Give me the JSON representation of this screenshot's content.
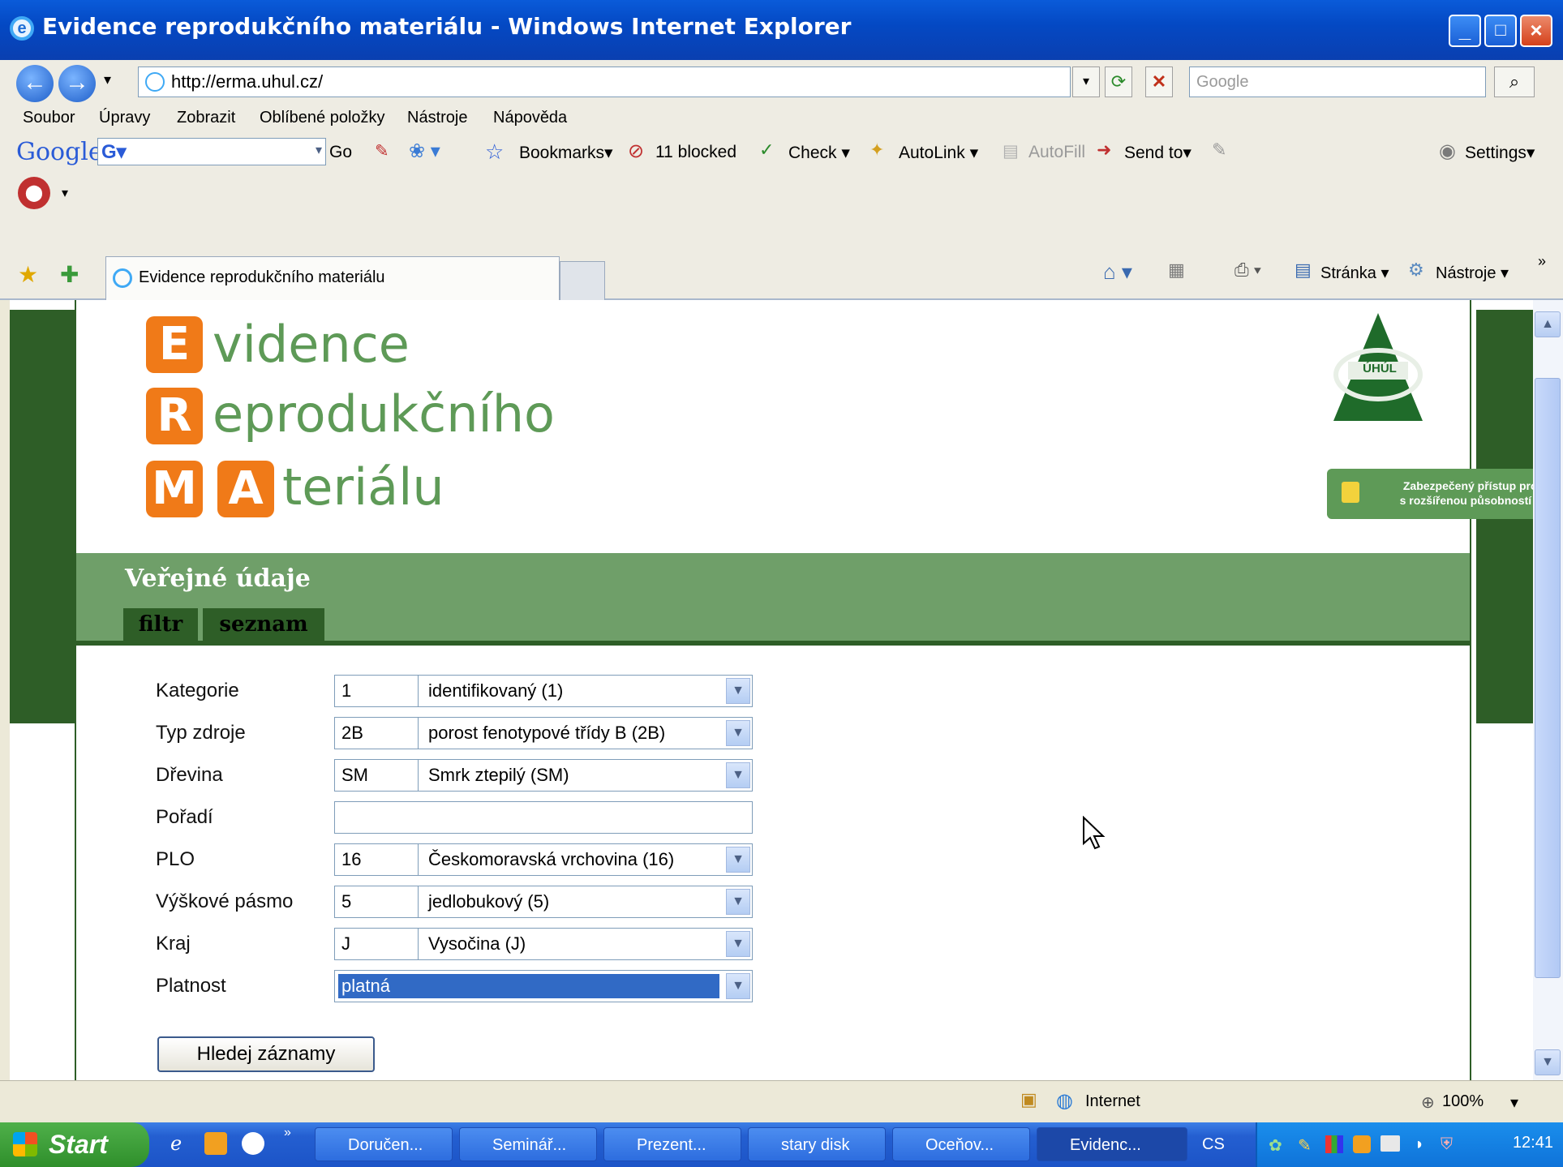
{
  "window": {
    "title": "Evidence reprodukčního materiálu - Windows Internet Explorer"
  },
  "address": {
    "url": "http://erma.uhul.cz/",
    "search_placeholder": "Google"
  },
  "menu": [
    "Soubor",
    "Úpravy",
    "Zobrazit",
    "Oblíbené položky",
    "Nástroje",
    "Nápověda"
  ],
  "google_toolbar": {
    "brand": "Google",
    "go": "Go",
    "bookmarks": "Bookmarks",
    "blocked": "11 blocked",
    "check": "Check",
    "autolink": "AutoLink",
    "autofill": "AutoFill",
    "send_to": "Send to",
    "settings": "Settings"
  },
  "tabs": {
    "active_tab": "Evidence reprodukčního materiálu",
    "page": "Stránka",
    "tools": "Nástroje"
  },
  "logo": {
    "l1_letter": "E",
    "l1_word": "vidence",
    "l2_letter": "R",
    "l2_word": "eprodukčního",
    "l3_letter1": "M",
    "l3_letter2": "A",
    "l3_word": "teriálu"
  },
  "emblem_text": "ÚHÚL",
  "secure_link": {
    "line1": "Zabezpečený přístup pro obce",
    "line2": "s rozšířenou působností a kraje",
    "arrow": ">"
  },
  "section": {
    "title": "Veřejné údaje",
    "tab_filtr": "filtr",
    "tab_seznam": "seznam"
  },
  "form": {
    "rows": [
      {
        "label": "Kategorie",
        "code": "1",
        "value": "identifikovaný (1)"
      },
      {
        "label": "Typ zdroje",
        "code": "2B",
        "value": "porost fenotypové třídy B (2B)"
      },
      {
        "label": "Dřevina",
        "code": "SM",
        "value": "Smrk ztepilý (SM)"
      },
      {
        "label": "Pořadí",
        "code": "",
        "value": ""
      },
      {
        "label": "PLO",
        "code": "16",
        "value": "Českomoravská vrchovina (16)"
      },
      {
        "label": "Výškové pásmo",
        "code": "5",
        "value": "jedlobukový (5)"
      },
      {
        "label": "Kraj",
        "code": "J",
        "value": "Vysočina (J)"
      },
      {
        "label": "Platnost",
        "code": "",
        "value": "platná"
      }
    ],
    "submit": "Hledej záznamy"
  },
  "status": {
    "zone": "Internet",
    "zoom": "100%"
  },
  "taskbar": {
    "start": "Start",
    "tasks": [
      "Doručen...",
      "Seminář...",
      "Prezent...",
      "stary disk",
      "Oceňov...",
      "Evidenc..."
    ],
    "lang": "CS",
    "clock": "12:41"
  }
}
